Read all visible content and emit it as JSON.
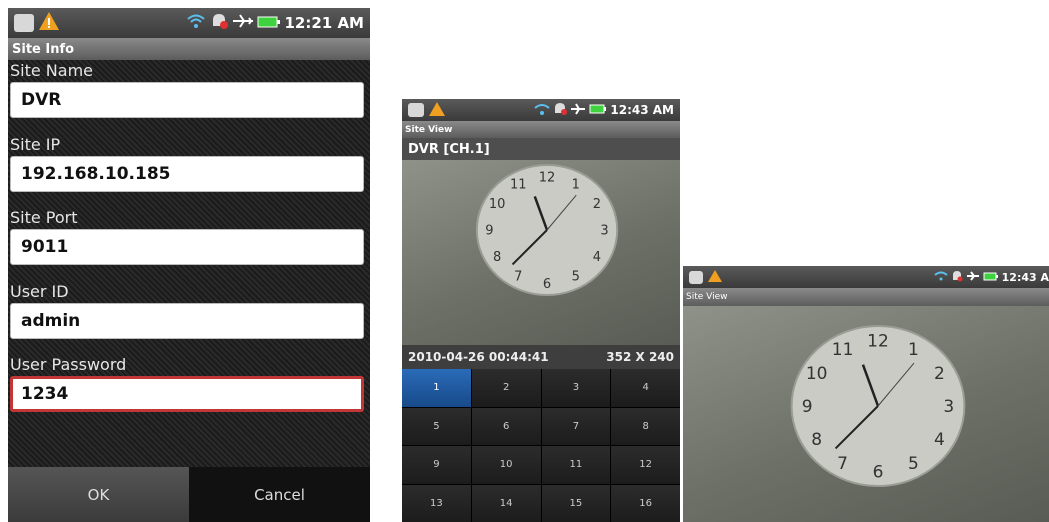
{
  "screen1": {
    "status": {
      "time": "12:21 AM"
    },
    "title": "Site Info",
    "fields": [
      {
        "label": "Site Name",
        "value": "DVR"
      },
      {
        "label": "Site IP",
        "value": "192.168.10.185"
      },
      {
        "label": "Site Port",
        "value": "9011"
      },
      {
        "label": "User ID",
        "value": "admin"
      },
      {
        "label": "User Password",
        "value": "1234"
      }
    ],
    "buttons": {
      "ok": "OK",
      "cancel": "Cancel"
    }
  },
  "screen2": {
    "status": {
      "time": "12:43 AM"
    },
    "title": "Site View",
    "channel": "DVR [CH.1]",
    "datetime": "2010-04-26 00:44:41",
    "resolution": "352 X 240",
    "channels": [
      "1",
      "2",
      "3",
      "4",
      "5",
      "6",
      "7",
      "8",
      "9",
      "10",
      "11",
      "12",
      "13",
      "14",
      "15",
      "16"
    ],
    "selected_channel": "1"
  },
  "screen3": {
    "status": {
      "time": "12:43 A"
    },
    "title": "Site View"
  },
  "clock_numerals": [
    "12",
    "1",
    "2",
    "3",
    "4",
    "5",
    "6",
    "7",
    "8",
    "9",
    "10",
    "11"
  ],
  "colors": {
    "accent_selected": "#1f5fa8",
    "focus_border": "#c23636",
    "battery": "#3fd23f",
    "warning": "#f0a020"
  }
}
